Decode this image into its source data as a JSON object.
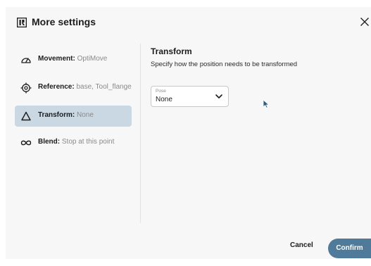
{
  "dialog": {
    "title": "More settings",
    "logo_icon": "robot-logo-icon",
    "close_icon": "close-icon"
  },
  "sidebar": {
    "items": [
      {
        "key": "Movement:",
        "value": "OptiMove",
        "icon": "speedometer-icon",
        "active": false
      },
      {
        "key": "Reference:",
        "value": "base, Tool_flange",
        "icon": "target-icon",
        "active": false
      },
      {
        "key": "Transform:",
        "value": "None",
        "icon": "triangle-icon",
        "active": true
      },
      {
        "key": "Blend:",
        "value": "Stop at this point",
        "icon": "infinity-icon",
        "active": false
      }
    ]
  },
  "main": {
    "title": "Transform",
    "description": "Specify how the position needs to be transformed",
    "pose": {
      "label": "Pose",
      "value": "None"
    }
  },
  "footer": {
    "cancel_label": "Cancel",
    "confirm_label": "Confirm"
  },
  "colors": {
    "accent": "#4f7a99",
    "active_bg": "#c9d8e3",
    "dialog_bg": "#f7f7f7"
  }
}
